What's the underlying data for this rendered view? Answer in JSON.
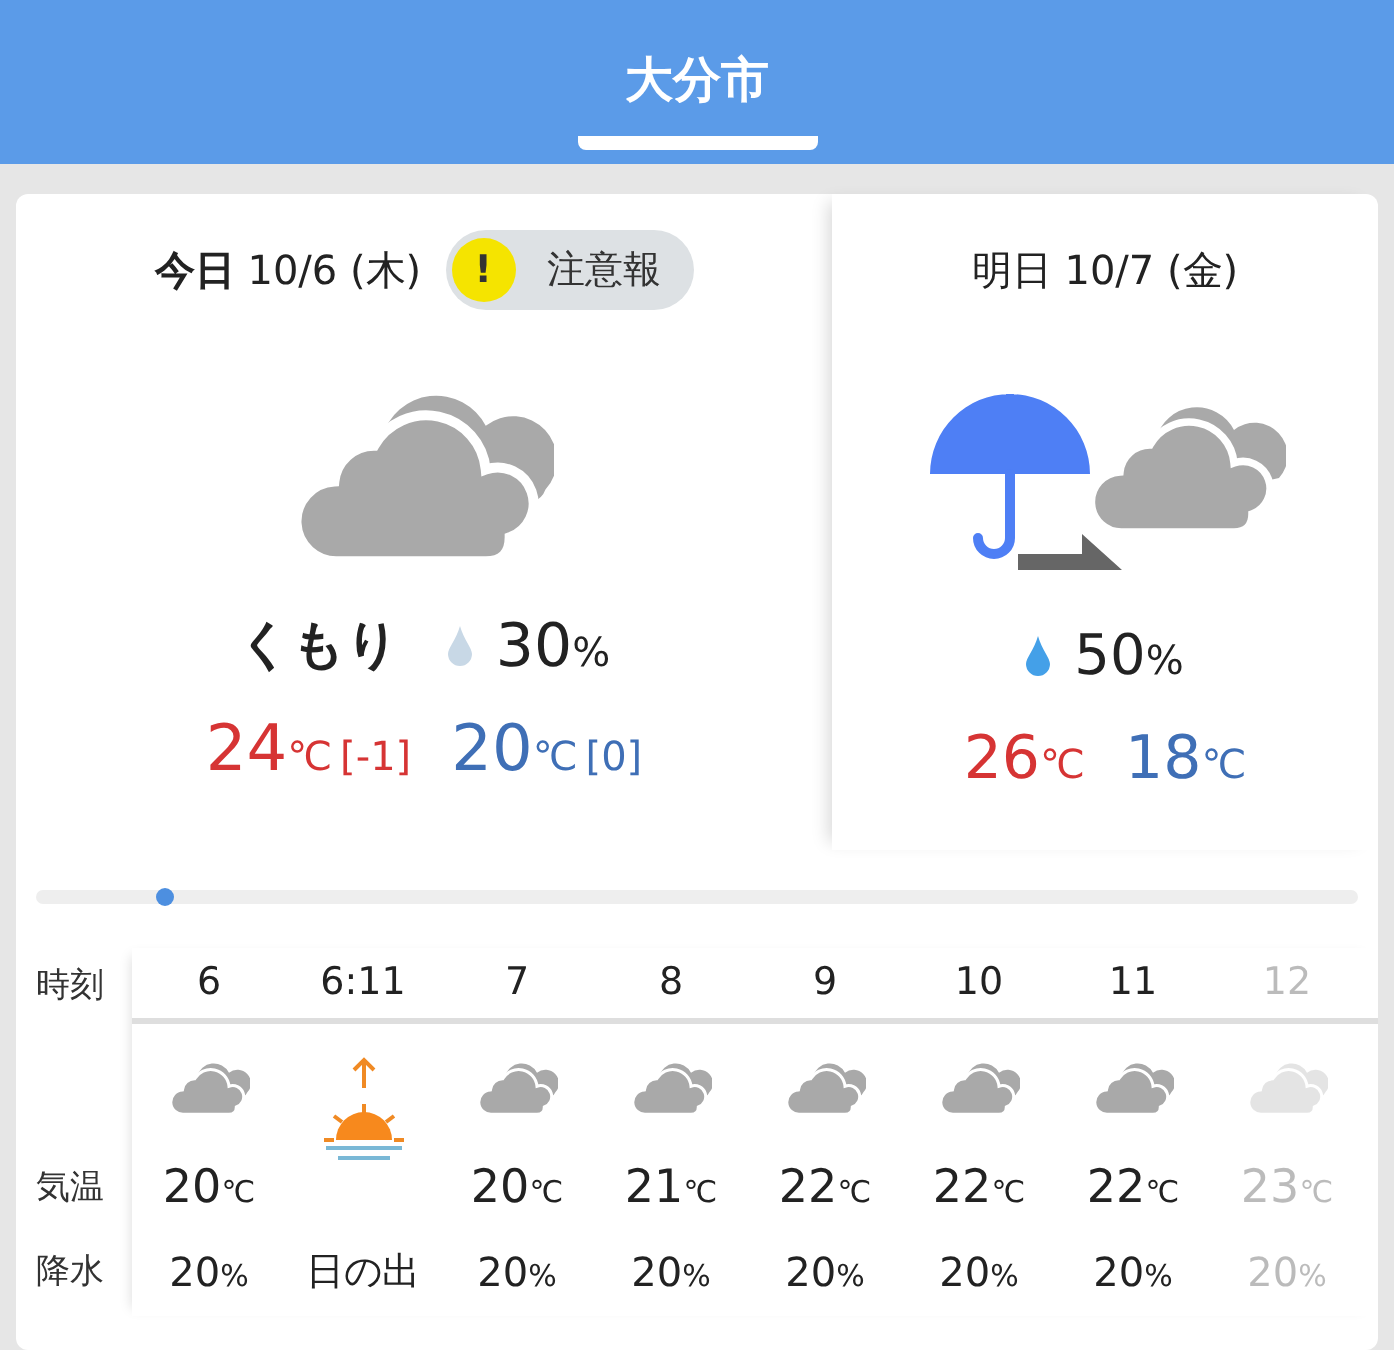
{
  "header": {
    "title": "大分市",
    "selected": true
  },
  "today": {
    "label": "今日",
    "date": "10/6 (木)",
    "alert": {
      "mark": "!",
      "text": "注意報"
    },
    "kind": "cloudy",
    "weather": "くもり",
    "precip": {
      "value": "30",
      "unit": "%"
    },
    "high": {
      "value": "24",
      "unit": "℃",
      "diff": "[-1]"
    },
    "low": {
      "value": "20",
      "unit": "℃",
      "diff": "[0]"
    }
  },
  "tomorrow": {
    "label": "明日",
    "date": "10/7 (金)",
    "kind": "rain-then-cloudy",
    "precip": {
      "value": "50",
      "unit": "%"
    },
    "high": {
      "value": "26",
      "unit": "℃"
    },
    "low": {
      "value": "18",
      "unit": "℃"
    }
  },
  "hourly": {
    "row_labels": [
      "時刻",
      "気温",
      "降水"
    ],
    "hours": [
      {
        "kind": "weather",
        "time": "6",
        "temp": "20",
        "temp_unit": "℃",
        "precip": "20",
        "precip_unit": "%",
        "faded": false
      },
      {
        "kind": "sunrise",
        "time": "6:11",
        "caption": "日の出",
        "faded": false
      },
      {
        "kind": "weather",
        "time": "7",
        "temp": "20",
        "temp_unit": "℃",
        "precip": "20",
        "precip_unit": "%",
        "faded": false
      },
      {
        "kind": "weather",
        "time": "8",
        "temp": "21",
        "temp_unit": "℃",
        "precip": "20",
        "precip_unit": "%",
        "faded": false
      },
      {
        "kind": "weather",
        "time": "9",
        "temp": "22",
        "temp_unit": "℃",
        "precip": "20",
        "precip_unit": "%",
        "faded": false
      },
      {
        "kind": "weather",
        "time": "10",
        "temp": "22",
        "temp_unit": "℃",
        "precip": "20",
        "precip_unit": "%",
        "faded": false
      },
      {
        "kind": "weather",
        "time": "11",
        "temp": "22",
        "temp_unit": "℃",
        "precip": "20",
        "precip_unit": "%",
        "faded": false
      },
      {
        "kind": "weather",
        "time": "12",
        "temp": "23",
        "temp_unit": "℃",
        "precip": "20",
        "precip_unit": "%",
        "faded": true
      }
    ]
  }
}
